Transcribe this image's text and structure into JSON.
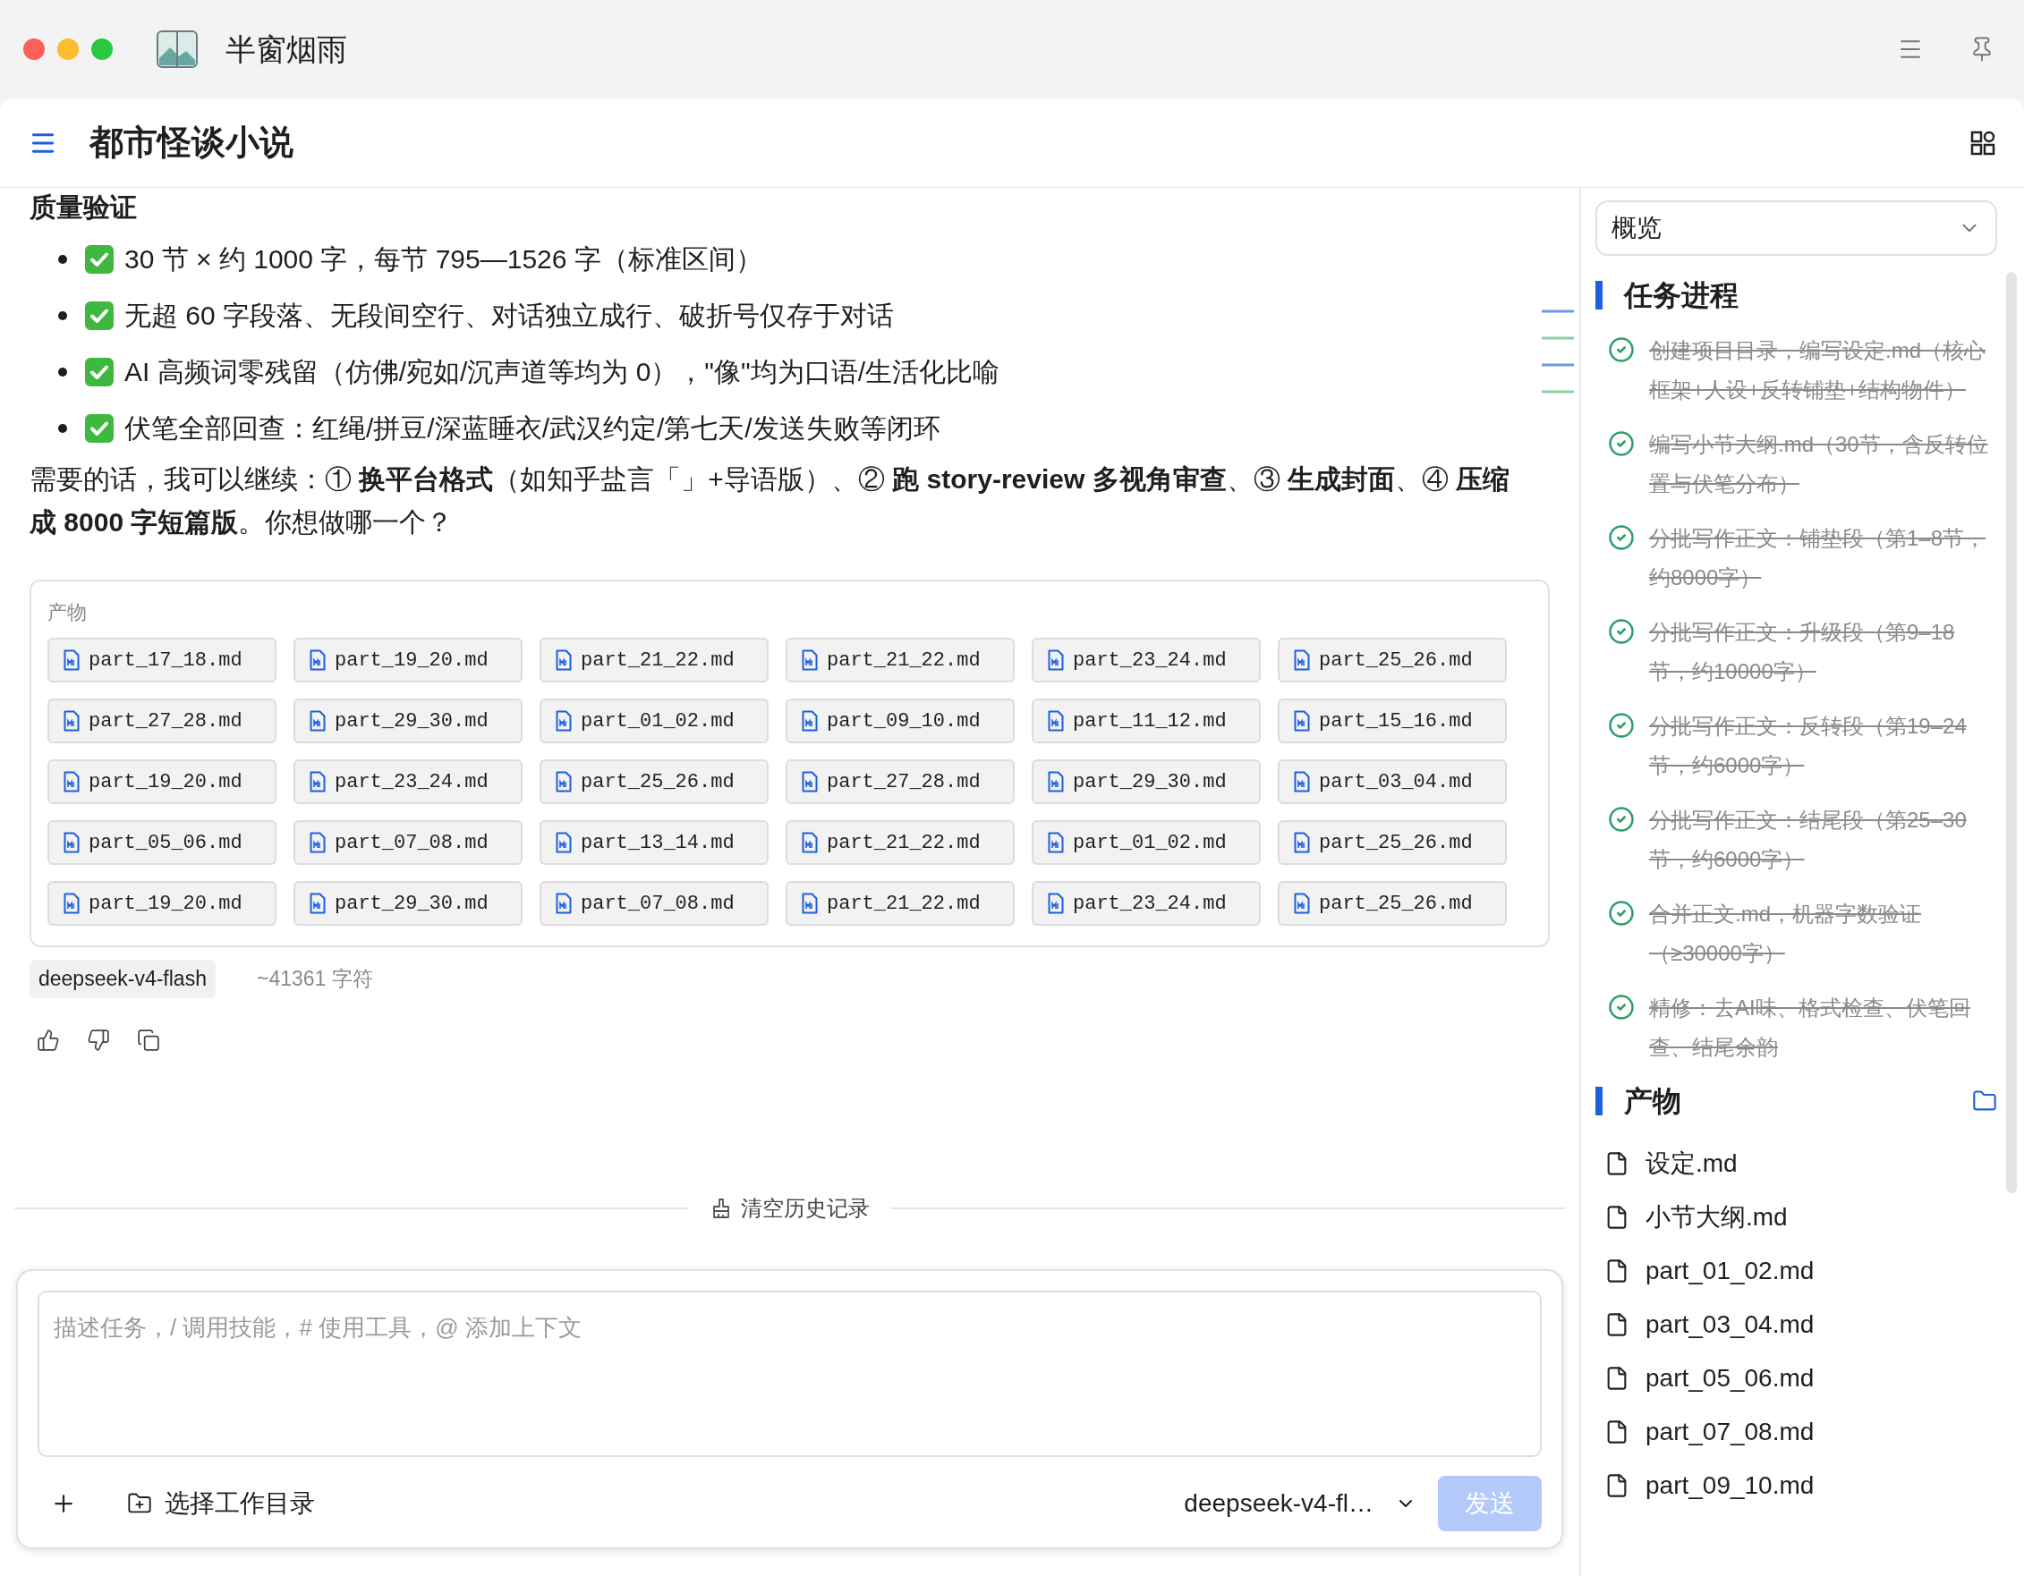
{
  "window": {
    "title": "半窗烟雨"
  },
  "header": {
    "title": "都市怪谈小说"
  },
  "message": {
    "heading": "质量验证",
    "checklist": [
      {
        "text": "30 节 × 约 1000 字，每节 795—1526 字（标准区间）",
        "checked": true
      },
      {
        "text": "无超 60 字段落、无段间空行、对话独立成行、破折号仅存于对话",
        "checked": true
      },
      {
        "text": "AI 高频词零残留（仿佛/宛如/沉声道等均为 0），\"像\"均为口语/生活化比喻",
        "checked": true
      },
      {
        "text": "伏笔全部回查：红绳/拼豆/深蓝睡衣/武汉约定/第七天/发送失败等闭环",
        "checked": true
      }
    ],
    "followup": "需要的话，我可以继续：① **换平台格式**（如知乎盐言「」+导语版）、② **跑 story-review 多视角审查**、③ **生成封面**、④ **压缩成 8000 字短篇版**。你想做哪一个？",
    "artifacts": {
      "label": "产物",
      "files": [
        "part_17_18.md",
        "part_19_20.md",
        "part_21_22.md",
        "part_21_22.md",
        "part_23_24.md",
        "part_25_26.md",
        "part_27_28.md",
        "part_29_30.md",
        "part_01_02.md",
        "part_09_10.md",
        "part_11_12.md",
        "part_15_16.md",
        "part_19_20.md",
        "part_23_24.md",
        "part_25_26.md",
        "part_27_28.md",
        "part_29_30.md",
        "part_03_04.md",
        "part_05_06.md",
        "part_07_08.md",
        "part_13_14.md",
        "part_21_22.md",
        "part_01_02.md",
        "part_25_26.md",
        "part_19_20.md",
        "part_29_30.md",
        "part_07_08.md",
        "part_21_22.md",
        "part_23_24.md",
        "part_25_26.md"
      ]
    },
    "model_tag": "deepseek-v4-flash",
    "char_count": "~41361 字符"
  },
  "clear_history": "清空历史记录",
  "composer": {
    "placeholder": "描述任务，/ 调用技能，# 使用工具，@ 添加上下文",
    "workdir": "选择工作目录",
    "model": "deepseek-v4-fl…",
    "send": "发送",
    "disabled": true
  },
  "sidebar": {
    "view_select": "概览",
    "tasks_title": "任务进程",
    "tasks": [
      {
        "text": "创建项目目录，编写设定.md（核心框架+人设+反转铺垫+结构物件）",
        "done": true
      },
      {
        "text": "编写小节大纲.md（30节，含反转位置与伏笔分布）",
        "done": true
      },
      {
        "text": "分批写作正文：铺垫段（第1–8节，约8000字）",
        "done": true
      },
      {
        "text": "分批写作正文：升级段（第9–18节，约10000字）",
        "done": true
      },
      {
        "text": "分批写作正文：反转段（第19–24节，约6000字）",
        "done": true
      },
      {
        "text": "分批写作正文：结尾段（第25–30节，约6000字）",
        "done": true
      },
      {
        "text": "合并正文.md，机器字数验证（≥30000字）",
        "done": true
      },
      {
        "text": "精修：去AI味、格式检查、伏笔回查、结尾余韵",
        "done": true
      }
    ],
    "outputs_title": "产物",
    "outputs": [
      "设定.md",
      "小节大纲.md",
      "part_01_02.md",
      "part_03_04.md",
      "part_05_06.md",
      "part_07_08.md",
      "part_09_10.md"
    ]
  }
}
